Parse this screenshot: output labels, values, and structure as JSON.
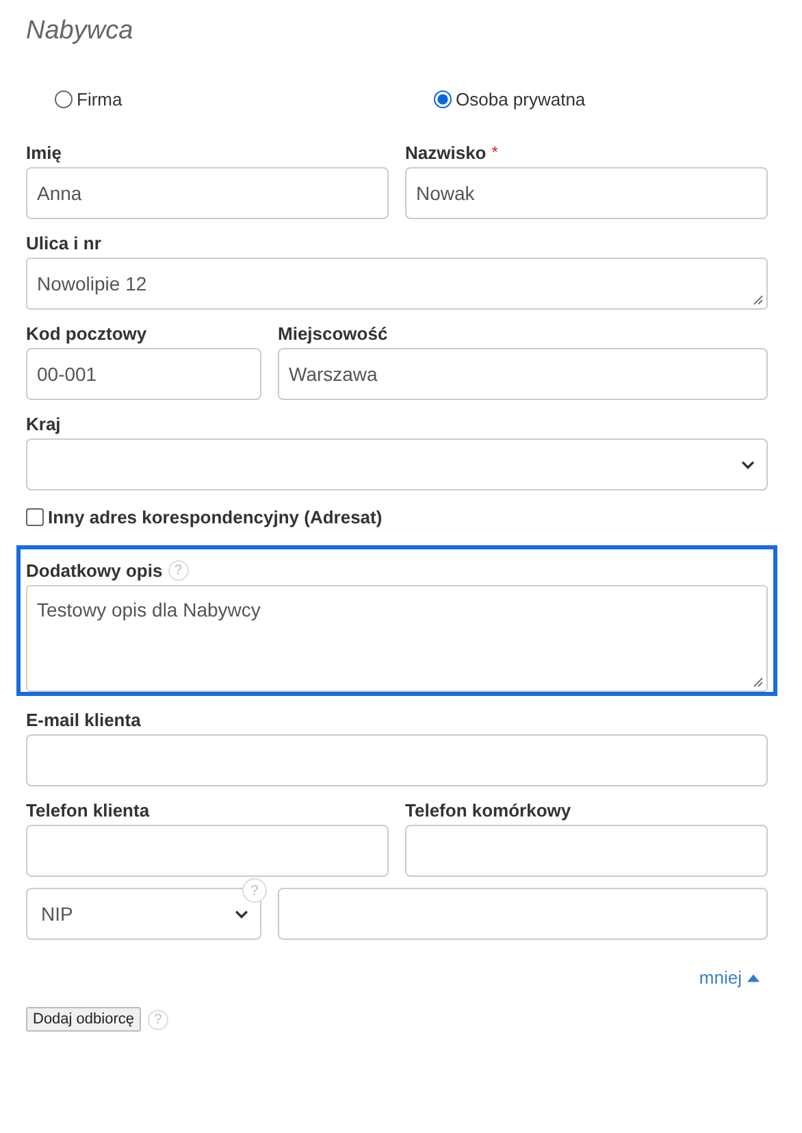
{
  "title": "Nabywca",
  "customer_types": [
    {
      "label": "Firma",
      "selected": false
    },
    {
      "label": "Osoba prywatna",
      "selected": true
    }
  ],
  "rows": [
    {
      "kind": "pair",
      "fields": [
        {
          "kind": "text",
          "label": "Imię",
          "value": "Anna"
        },
        {
          "kind": "text",
          "label": "Nazwisko",
          "required_mark": "*",
          "value": "Nowak"
        }
      ]
    },
    {
      "kind": "full",
      "fields": [
        {
          "kind": "textarea",
          "label": "Ulica i nr",
          "value": "Nowolipie 12"
        }
      ]
    },
    {
      "kind": "short-long",
      "fields": [
        {
          "kind": "text",
          "label": "Kod pocztowy",
          "value": "00-001"
        },
        {
          "kind": "text",
          "label": "Miejscowość",
          "value": "Warszawa"
        }
      ]
    },
    {
      "kind": "full",
      "fields": [
        {
          "kind": "select",
          "label": "Kraj"
        }
      ]
    },
    {
      "kind": "checkbox",
      "label": "Inny adres korespondencyjny (Adresat)",
      "checked": false
    },
    {
      "kind": "full",
      "highlighted": true,
      "fields": [
        {
          "kind": "textarea-tall",
          "label": "Dodatkowy opis",
          "help": "?",
          "value": "Testowy opis dla Nabywcy"
        }
      ]
    },
    {
      "kind": "full",
      "fields": [
        {
          "kind": "text",
          "label": "E-mail klienta"
        }
      ]
    },
    {
      "kind": "pair",
      "fields": [
        {
          "kind": "text",
          "label": "Telefon klienta"
        },
        {
          "kind": "text",
          "label": "Telefon komórkowy"
        }
      ]
    },
    {
      "kind": "short-long",
      "fields": [
        {
          "kind": "select",
          "value": "NIP",
          "help": "?"
        },
        {
          "kind": "text"
        }
      ]
    }
  ],
  "toggle_link": {
    "label": "mniej",
    "expanded": true
  },
  "add_button": {
    "label": "Dodaj odbiorcę",
    "help": "?"
  }
}
